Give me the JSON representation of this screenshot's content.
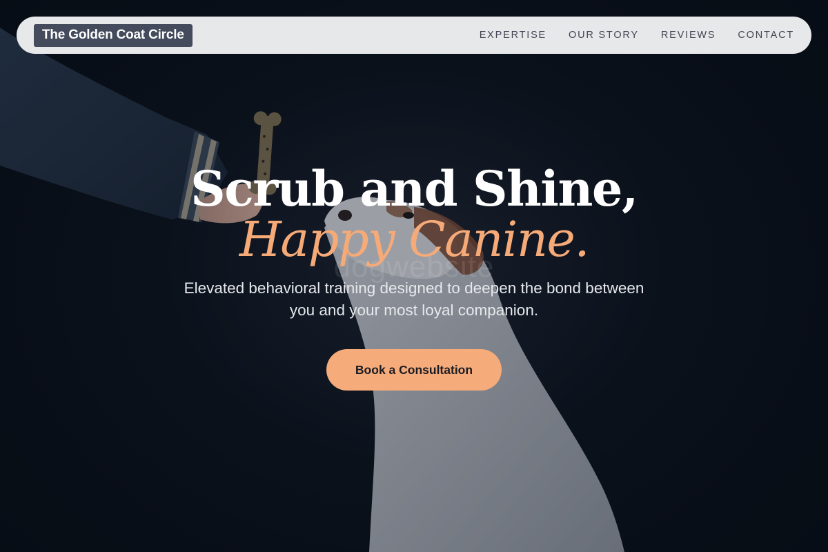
{
  "brand": {
    "name": "The Golden Coat Circle"
  },
  "nav": {
    "items": [
      {
        "label": "EXPERTISE"
      },
      {
        "label": "OUR STORY"
      },
      {
        "label": "REVIEWS"
      },
      {
        "label": "CONTACT"
      }
    ]
  },
  "hero": {
    "headline_line1": "Scrub and Shine,",
    "headline_line2": "Happy Canine.",
    "subtitle": "Elevated behavioral training designed to deepen the bond between you and your most loyal companion.",
    "cta_label": "Book a Consultation",
    "watermark": "dogwebsite",
    "image": "hand-giving-treat-to-dog"
  },
  "colors": {
    "accent": "#f6aa78",
    "nav_background": "#e7e8ea",
    "brand_badge": "#434b5c",
    "page_background": "#0b121c"
  }
}
